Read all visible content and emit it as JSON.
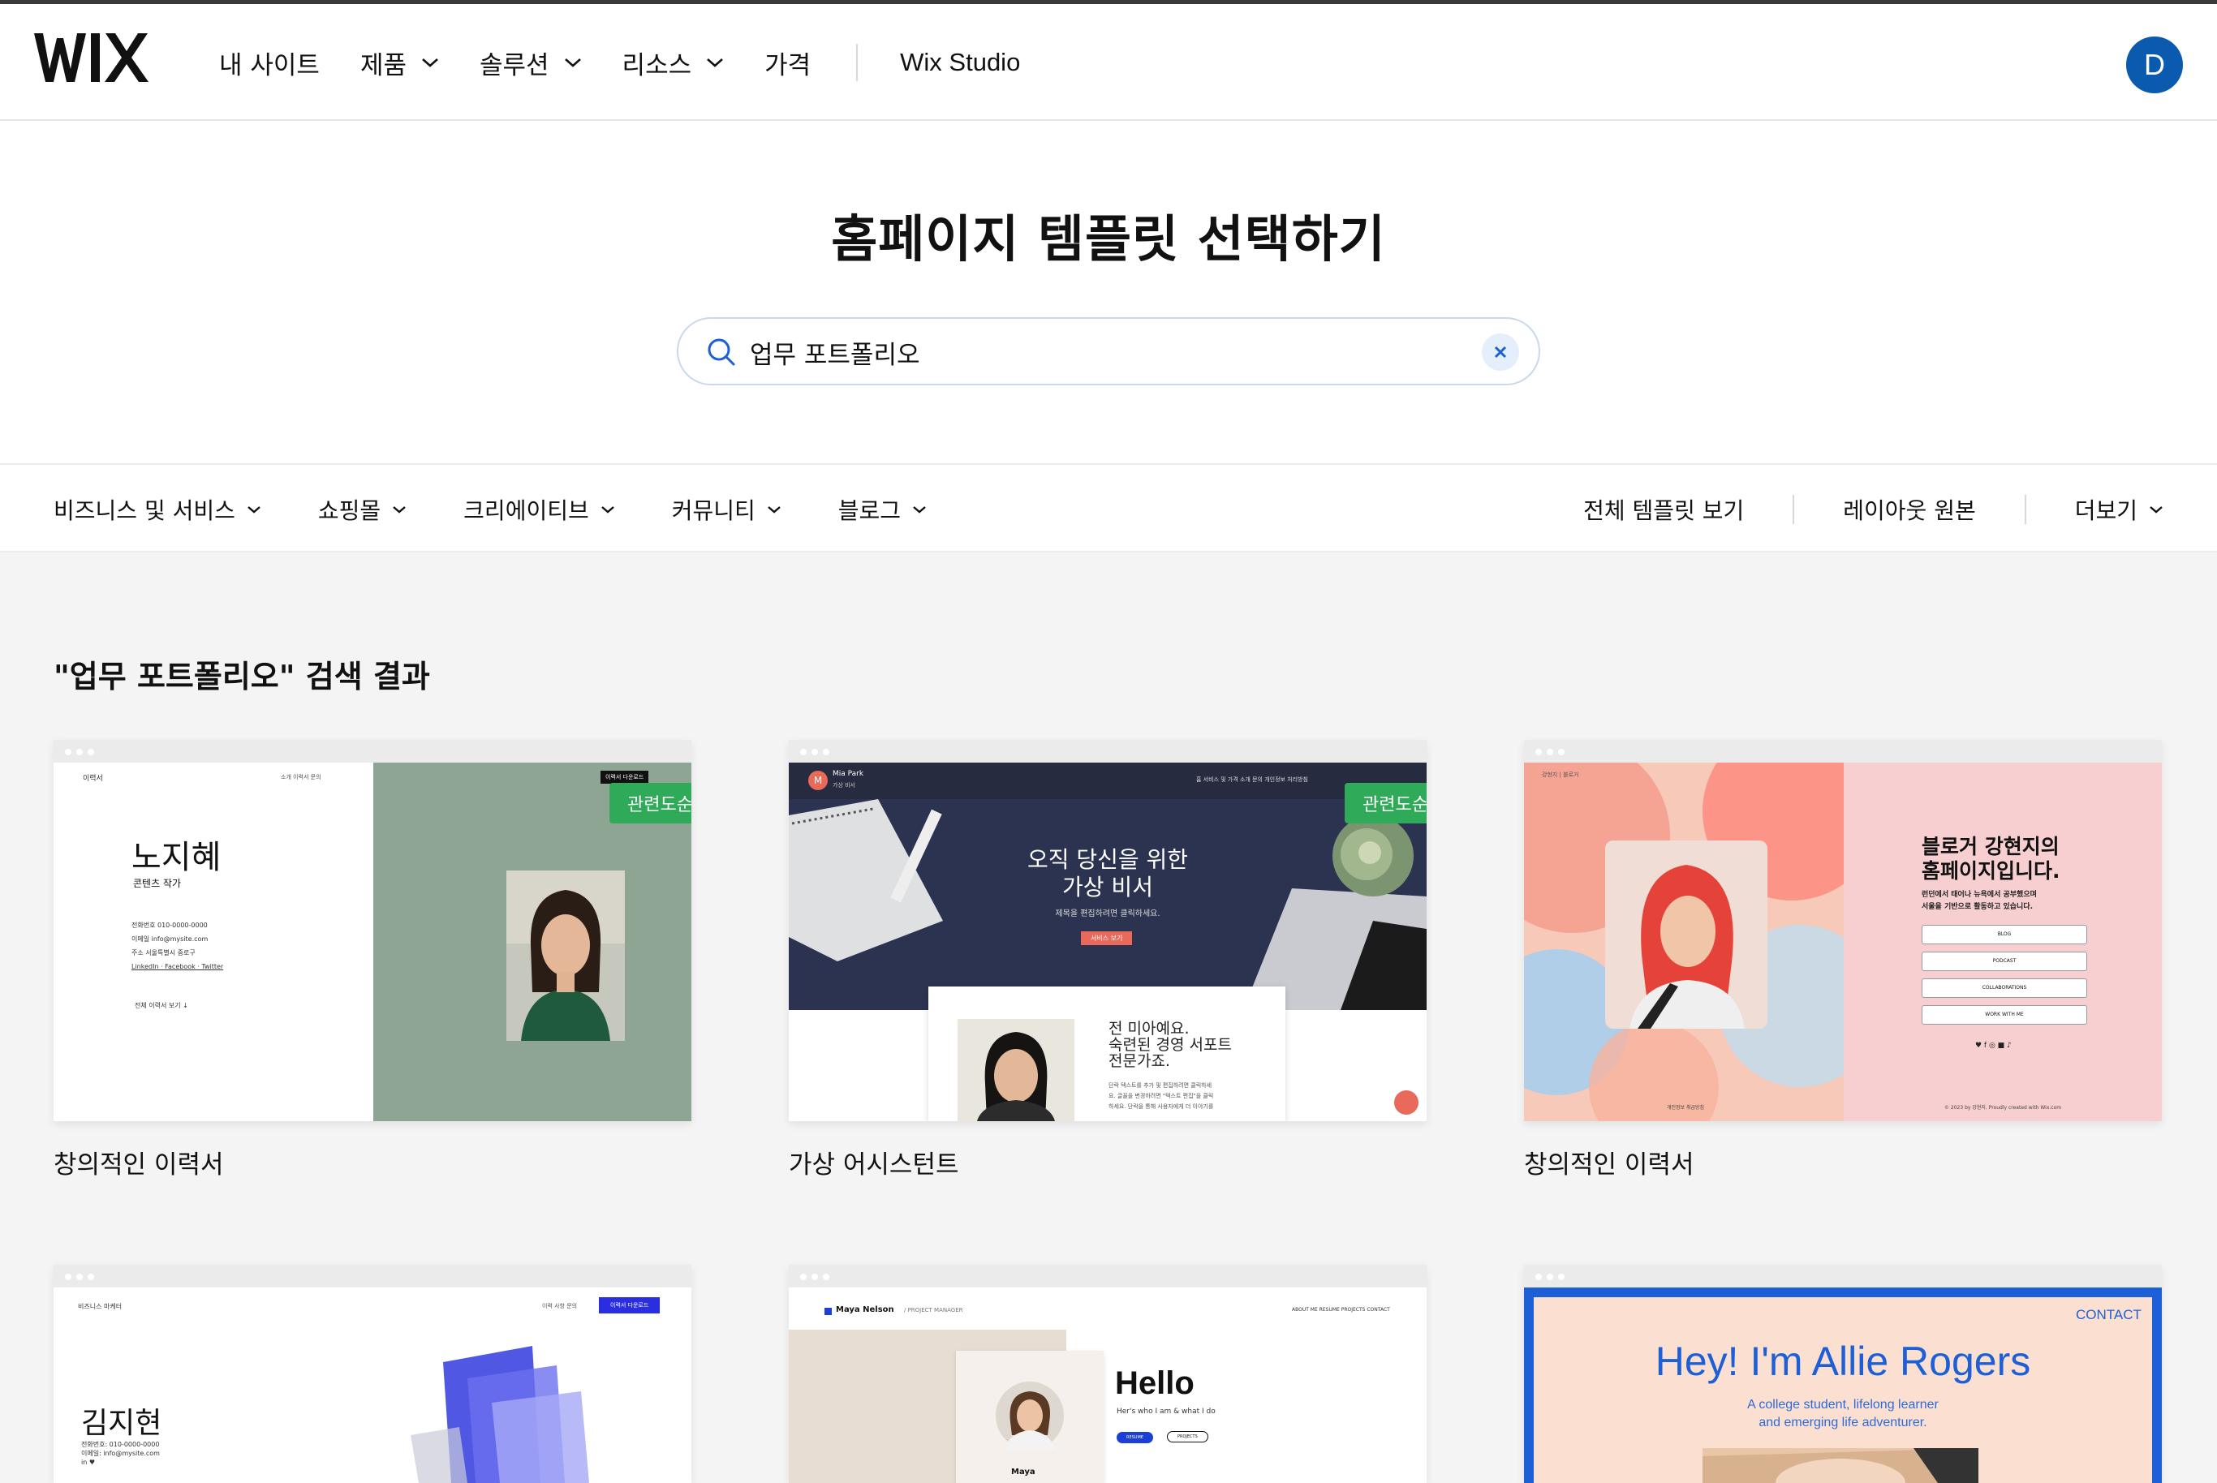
{
  "header": {
    "logo": "WIX",
    "nav": [
      {
        "label": "내 사이트",
        "dropdown": false
      },
      {
        "label": "제품",
        "dropdown": true
      },
      {
        "label": "솔루션",
        "dropdown": true
      },
      {
        "label": "리소스",
        "dropdown": true
      },
      {
        "label": "가격",
        "dropdown": false
      }
    ],
    "studio_label": "Wix Studio",
    "avatar_initial": "D"
  },
  "hero": {
    "title": "홈페이지 템플릿 선택하기",
    "search_value": "업무 포트폴리오"
  },
  "categories": {
    "left": [
      "비즈니스 및 서비스",
      "쇼핑몰",
      "크리에이티브",
      "커뮤니티",
      "블로그"
    ],
    "all_templates": "전체 템플릿 보기",
    "layouts": "레이아웃 원본",
    "more": "더보기"
  },
  "results": {
    "heading_query": "\"업무 포트폴리오\"",
    "heading_suffix": " 검색 결과",
    "badge_label": "관련도순",
    "cards": [
      {
        "title": "창의적인 이력서",
        "preview": {
          "site_label": "이력서",
          "menu": "소개   이력서   문의",
          "download_button": "이력서 다운로드",
          "name": "노지혜",
          "role": "콘텐츠 작가",
          "info": [
            "전화번호 010-0000-0000",
            "이메일 info@mysite.com",
            "주소 서울특별시 중로구",
            "LinkedIn · Facebook · Twitter"
          ],
          "more_link": "전체 이력서 보기   ↓"
        }
      },
      {
        "title": "가상 어시스턴트",
        "preview": {
          "brand_name": "Mia Park",
          "brand_sub": "가상 비서",
          "menu": "홈   서비스 및 가격   소개   문의   개인정보 처리방침",
          "headline1": "오직 당신을 위한",
          "headline2": "가상 비서",
          "sub": "제목을 편집하려면 클릭하세요.",
          "cta": "서비스 보기",
          "intro": [
            "전 미아예요.",
            "숙련된 경영 서포트",
            "전문가죠."
          ],
          "body": [
            "단락 텍스트를 추가 및 편집하려면 클릭하세",
            "요. 글꼴을 변경하려면 \"텍스트 편집\"을 클릭",
            "하세요. 단락을 통해 사용자에게 더 이야기를"
          ]
        }
      },
      {
        "title": "창의적인 이력서",
        "preview": {
          "site_label": "강현지 | 블로거",
          "headline": [
            "블로거 강현지의",
            "홈페이지입니다."
          ],
          "sub": [
            "런던에서 태어나 뉴욕에서 공부했으며",
            "서울을 기반으로 활동하고 있습니다."
          ],
          "buttons": [
            "BLOG",
            "PODCAST",
            "COLLABORATIONS",
            "WORK WITH ME"
          ],
          "social": "♥  f  ◎  ■  ♪",
          "footer_left": "개인정보 취급방침",
          "footer_right": "© 2023 by 강현지. Proudly created with Wix.com"
        }
      },
      {
        "preview": {
          "site_label": "비즈니스 마케터",
          "menu": "이력 사항   문의",
          "button": "이력서 다운로드",
          "name": "김지현",
          "info": [
            "전화번호: 010-0000-0000",
            "이메일: info@mysite.com",
            "in  ♥"
          ]
        }
      },
      {
        "preview": {
          "brand": "Maya Nelson",
          "brand_role": "/ PROJECT MANAGER",
          "menu": "ABOUT ME   RESUME   PROJECTS   CONTACT",
          "hello": "Hello",
          "sub": "Her's who I am & what I do",
          "btn1": "RESUME",
          "btn2": "PROJECTS",
          "name": "Maya"
        }
      },
      {
        "preview": {
          "contact": "CONTACT",
          "headline": "Hey! I'm Allie Rogers",
          "sub1": "A college student, lifelong learner",
          "sub2": "and emerging life adventurer."
        }
      }
    ]
  },
  "colors": {
    "wix_blue": "#0a5bb0",
    "badge_green": "#2eaa59",
    "sage": "#8fa594",
    "navy": "#2b3350",
    "salmon": "#e96a5b",
    "pink": "#f7cfd0",
    "allie_blue": "#1c5fd6",
    "allie_peach": "#fbe0d2"
  }
}
